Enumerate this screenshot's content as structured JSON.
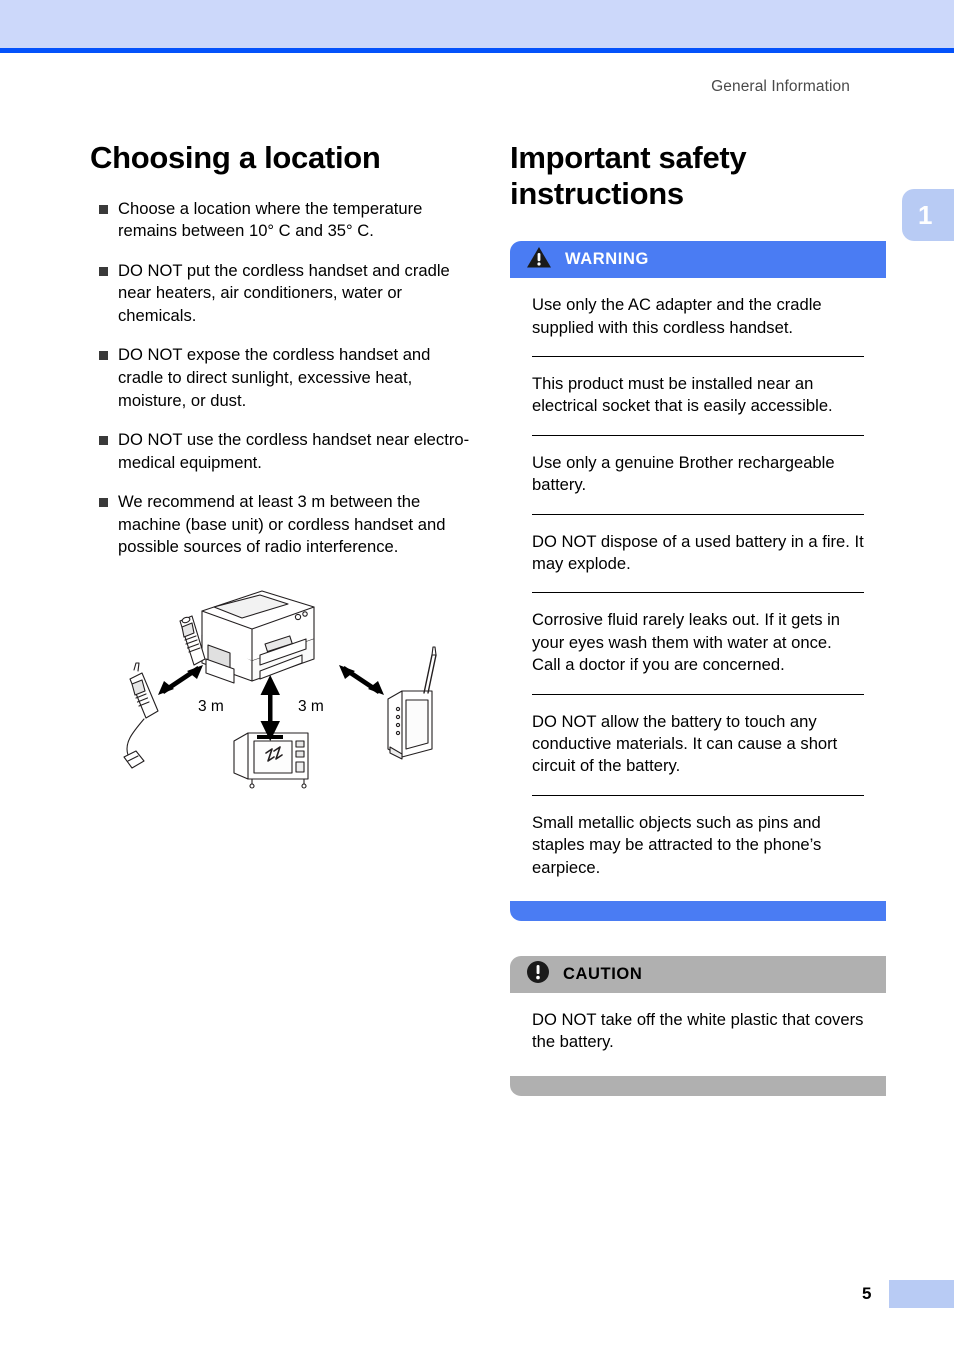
{
  "header": {
    "running_head": "General Information",
    "band_color": "#ccd8fa",
    "rule_color": "#0452fb"
  },
  "chapter_tab": {
    "number": "1",
    "color": "#b8cbf4"
  },
  "left_column": {
    "title": "Choosing a location",
    "bullets": [
      "Choose a location where the temperature remains between 10° C and 35° C.",
      "DO NOT put the cordless handset and cradle near heaters, air conditioners, water or chemicals.",
      "DO NOT expose the cordless handset and cradle to direct sunlight, excessive heat, moisture, or dust.",
      "DO NOT use the cordless handset near electro-medical equipment.",
      "We recommend at least 3 m between the machine (base unit) or cordless handset and possible sources of radio interference."
    ],
    "illustration": {
      "alt": "Placement diagram: machine with cordless handset at centre, 3 m from corded telephone, microwave oven and wireless router",
      "distance_label_left": "3 m",
      "distance_label_right": "3 m",
      "devices": [
        "fax-machine",
        "cordless-handset",
        "corded-telephone",
        "microwave-oven",
        "wireless-router"
      ]
    }
  },
  "right_column": {
    "title": "Important safety instructions",
    "warning": {
      "label": "WARNING",
      "icon": "warning-triangle-icon",
      "color": "#4a7cf3",
      "items": [
        "Use only the AC adapter and the cradle supplied with this cordless handset.",
        "This product must be installed near an electrical socket that is easily accessible.",
        "Use only a genuine Brother rechargeable battery.",
        "DO NOT dispose of a used battery in a fire. It may explode.",
        "Corrosive fluid rarely leaks out. If it gets in your eyes wash them with water at once. Call a doctor if you are concerned.",
        "DO NOT allow the battery to touch any conductive materials. It can cause a short circuit of the battery.",
        "Small metallic objects such as pins and staples may be attracted to the phone’s earpiece."
      ]
    },
    "caution": {
      "label": "CAUTION",
      "icon": "caution-exclamation-icon",
      "color": "#b0b0b0",
      "items": [
        "DO NOT take off the white plastic that covers the battery."
      ]
    }
  },
  "footer": {
    "page_number": "5",
    "block_color": "#b8cbf4"
  }
}
